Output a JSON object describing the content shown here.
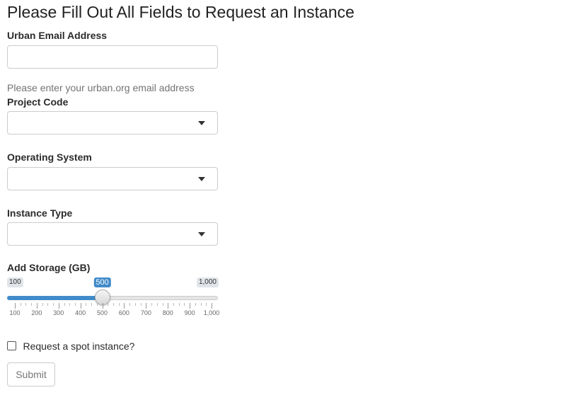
{
  "form": {
    "title": "Please Fill Out All Fields to Request an Instance",
    "email": {
      "label": "Urban Email Address",
      "value": "",
      "help": "Please enter your urban.org email address"
    },
    "project_code": {
      "label": "Project Code",
      "selected": ""
    },
    "operating_system": {
      "label": "Operating System",
      "selected": ""
    },
    "instance_type": {
      "label": "Instance Type",
      "selected": ""
    },
    "storage": {
      "label": "Add Storage (GB)",
      "min_label": "100",
      "max_label": "1,000",
      "value_label": "500",
      "min": 100,
      "max": 1000,
      "value": 500,
      "ticks": [
        "100",
        "200",
        "300",
        "400",
        "500",
        "600",
        "700",
        "800",
        "900",
        "1,000"
      ]
    },
    "spot_instance": {
      "label": "Request a spot instance?",
      "checked": false
    },
    "submit_label": "Submit"
  },
  "colors": {
    "accent": "#428bca",
    "border": "#cccccc",
    "help_text": "#737373"
  }
}
